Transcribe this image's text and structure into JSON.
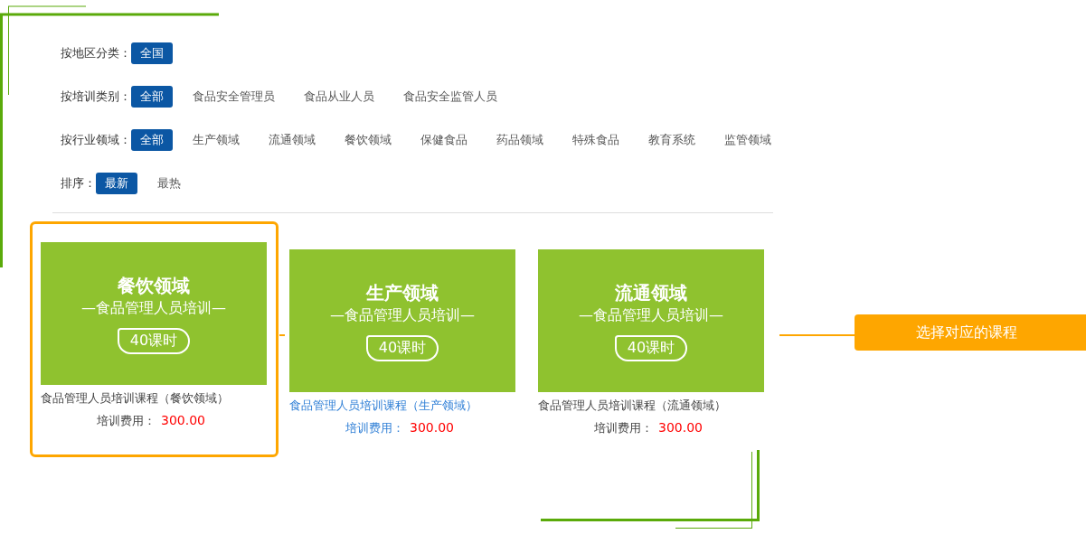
{
  "filters": [
    {
      "label": "按地区分类：",
      "options": [
        {
          "text": "全国",
          "selected": true
        }
      ]
    },
    {
      "label": "按培训类别：",
      "options": [
        {
          "text": "全部",
          "selected": true
        },
        {
          "text": "食品安全管理员",
          "selected": false
        },
        {
          "text": "食品从业人员",
          "selected": false
        },
        {
          "text": "食品安全监管人员",
          "selected": false
        }
      ]
    },
    {
      "label": "按行业领域：",
      "options": [
        {
          "text": "全部",
          "selected": true
        },
        {
          "text": "生产领域",
          "selected": false
        },
        {
          "text": "流通领域",
          "selected": false
        },
        {
          "text": "餐饮领域",
          "selected": false
        },
        {
          "text": "保健食品",
          "selected": false
        },
        {
          "text": "药品领域",
          "selected": false
        },
        {
          "text": "特殊食品",
          "selected": false
        },
        {
          "text": "教育系统",
          "selected": false
        },
        {
          "text": "监管领域",
          "selected": false
        }
      ]
    },
    {
      "label": "排序：",
      "options": [
        {
          "text": "最新",
          "selected": true
        },
        {
          "text": "最热",
          "selected": false
        }
      ]
    }
  ],
  "courses": [
    {
      "banner_title": "餐饮领域",
      "banner_subtitle": "—食品管理人员培训—",
      "hours": "40课时",
      "name": "食品管理人员培训课程（餐饮领域）",
      "fee_label": "培训费用：",
      "fee": "300.00",
      "selected": true,
      "hovered": false
    },
    {
      "banner_title": "生产领域",
      "banner_subtitle": "—食品管理人员培训—",
      "hours": "40课时",
      "name": "食品管理人员培训课程（生产领域）",
      "fee_label": "培训费用：",
      "fee": "300.00",
      "selected": false,
      "hovered": true
    },
    {
      "banner_title": "流通领域",
      "banner_subtitle": "—食品管理人员培训—",
      "hours": "40课时",
      "name": "食品管理人员培训课程（流通领域）",
      "fee_label": "培训费用：",
      "fee": "300.00",
      "selected": false,
      "hovered": false
    }
  ],
  "callout": {
    "text": "选择对应的课程"
  }
}
